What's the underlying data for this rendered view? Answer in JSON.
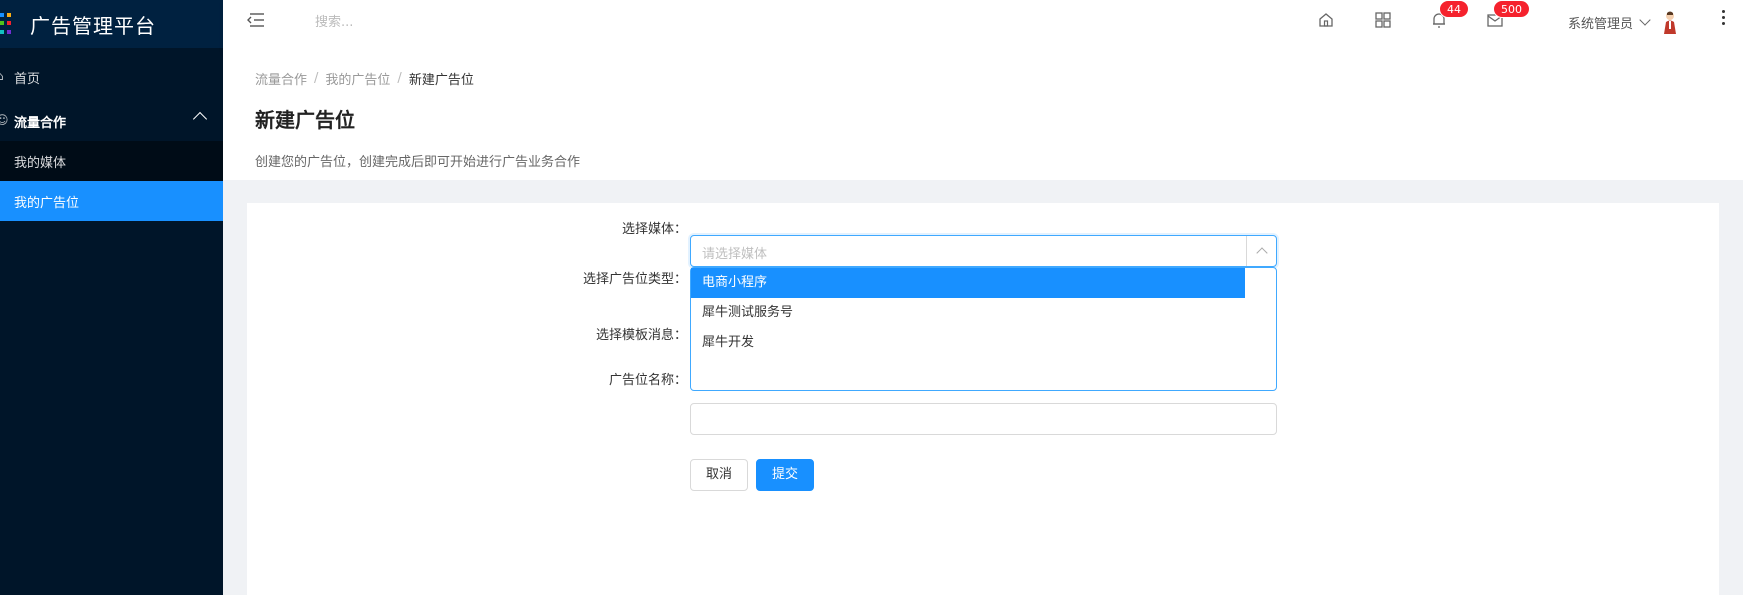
{
  "sidebar": {
    "title": "广告管理平台",
    "items": [
      {
        "label": "首页"
      },
      {
        "label": "流量合作"
      },
      {
        "label": "我的媒体"
      },
      {
        "label": "我的广告位"
      }
    ]
  },
  "header": {
    "search_placeholder": "搜索...",
    "notifications_badge": "44",
    "messages_badge": "500",
    "user_name": "系统管理员"
  },
  "breadcrumb": [
    "流量合作",
    "我的广告位",
    "新建广告位"
  ],
  "page": {
    "title": "新建广告位",
    "description": "创建您的广告位，创建完成后即可开始进行广告业务合作"
  },
  "form": {
    "media_label": "选择媒体：",
    "media_placeholder": "请选择媒体",
    "media_options": [
      "电商小程序",
      "犀牛测试服务号",
      "犀牛开发"
    ],
    "selected_option": "电商小程序",
    "type_label": "选择广告位类型：",
    "template_label": "选择模板消息：",
    "name_label": "广告位名称：",
    "cancel_label": "取消",
    "submit_label": "提交"
  },
  "colors": {
    "sidebar_bg": "#001529",
    "accent": "#1890ff",
    "badge": "#f5222d"
  }
}
